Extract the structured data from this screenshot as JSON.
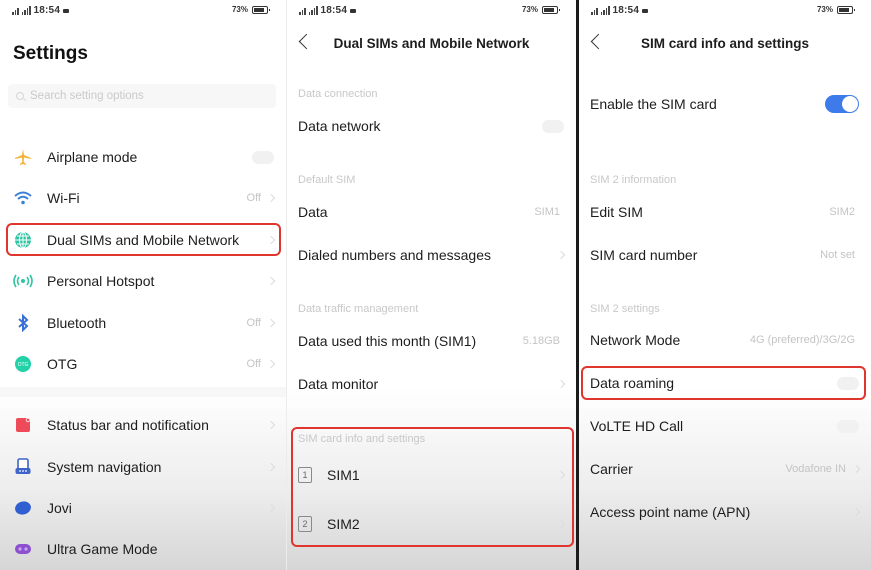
{
  "status_bar": {
    "time": "18:54",
    "battery": "73%",
    "battery_level": 0.73
  },
  "colors": {
    "highlight": "#e0352e",
    "toggle_on": "#3d7bea"
  },
  "screen1": {
    "title": "Settings",
    "search_placeholder": "Search setting options",
    "items": [
      {
        "label": "Airplane mode",
        "icon": "airplane-icon",
        "value": "",
        "toggle": "off"
      },
      {
        "label": "Wi-Fi",
        "icon": "wifi-icon",
        "value": "Off"
      },
      {
        "label": "Dual SIMs and Mobile Network",
        "icon": "globe-icon",
        "value": "",
        "highlighted": true
      },
      {
        "label": "Personal Hotspot",
        "icon": "hotspot-icon",
        "value": ""
      },
      {
        "label": "Bluetooth",
        "icon": "bluetooth-icon",
        "value": "Off"
      },
      {
        "label": "OTG",
        "icon": "otg-icon",
        "value": "Off"
      },
      {
        "label": "Status bar and notification",
        "icon": "status-bar-icon",
        "value": ""
      },
      {
        "label": "System navigation",
        "icon": "system-navigation-icon",
        "value": ""
      },
      {
        "label": "Jovi",
        "icon": "jovi-icon",
        "value": ""
      },
      {
        "label": "Ultra Game Mode",
        "icon": "game-mode-icon",
        "value": ""
      }
    ]
  },
  "screen2": {
    "title": "Dual SIMs and Mobile Network",
    "sections": {
      "data_connection": "Data connection",
      "default_sim": "Default SIM",
      "data_traffic": "Data traffic management",
      "sim_info": "SIM card info and settings"
    },
    "data_network": {
      "label": "Data network",
      "toggle": "off"
    },
    "data": {
      "label": "Data",
      "value": "SIM1"
    },
    "dialed": {
      "label": "Dialed numbers and messages"
    },
    "data_used": {
      "label": "Data used this month (SIM1)",
      "value": "5.18GB"
    },
    "data_monitor": {
      "label": "Data monitor"
    },
    "sim1": {
      "label": "SIM1",
      "badge": "1"
    },
    "sim2": {
      "label": "SIM2",
      "badge": "2"
    }
  },
  "screen3": {
    "title": "SIM card info and settings",
    "enable_sim": {
      "label": "Enable the SIM card",
      "toggle": "on"
    },
    "sections": {
      "info": "SIM 2 information",
      "settings": "SIM 2 settings"
    },
    "edit_sim": {
      "label": "Edit SIM",
      "value": "SIM2"
    },
    "sim_number": {
      "label": "SIM card number",
      "value": "Not set"
    },
    "network_mode": {
      "label": "Network Mode",
      "value": "4G (preferred)/3G/2G"
    },
    "data_roaming": {
      "label": "Data roaming",
      "toggle": "off"
    },
    "volte": {
      "label": "VoLTE HD Call",
      "toggle": "off"
    },
    "carrier": {
      "label": "Carrier",
      "value": "Vodafone IN"
    },
    "apn": {
      "label": "Access point name (APN)"
    }
  }
}
